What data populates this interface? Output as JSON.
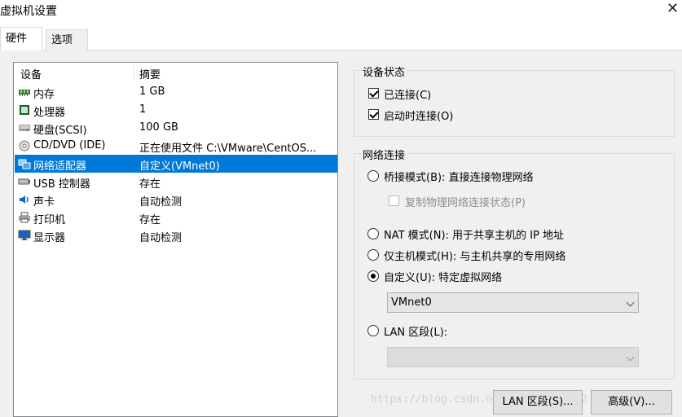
{
  "window": {
    "title": "虚拟机设置",
    "close_glyph": "✕"
  },
  "tabs": [
    {
      "label": "硬件"
    },
    {
      "label": "选项"
    }
  ],
  "device_list": {
    "headers": {
      "device": "设备",
      "summary": "摘要"
    },
    "rows": [
      {
        "name": "内存",
        "summary": "1 GB",
        "icon": "memory-icon"
      },
      {
        "name": "处理器",
        "summary": "1",
        "icon": "cpu-icon"
      },
      {
        "name": "硬盘(SCSI)",
        "summary": "100 GB",
        "icon": "harddisk-icon"
      },
      {
        "name": "CD/DVD (IDE)",
        "summary": "正在使用文件 C:\\VMware\\CentOS...",
        "icon": "cdrom-icon"
      },
      {
        "name": "网络适配器",
        "summary": "自定义(VMnet0)",
        "icon": "network-adapter-icon",
        "selected": true
      },
      {
        "name": "USB 控制器",
        "summary": "存在",
        "icon": "usb-icon"
      },
      {
        "name": "声卡",
        "summary": "自动检测",
        "icon": "sound-icon"
      },
      {
        "name": "打印机",
        "summary": "存在",
        "icon": "printer-icon"
      },
      {
        "name": "显示器",
        "summary": "自动检测",
        "icon": "display-icon"
      }
    ]
  },
  "device_status": {
    "group_label": "设备状态",
    "connected": {
      "label": "已连接(C)",
      "checked": true
    },
    "connect_at_power_on": {
      "label": "启动时连接(O)",
      "checked": true
    }
  },
  "network_connection": {
    "group_label": "网络连接",
    "bridged": {
      "label": "桥接模式(B): 直接连接物理网络",
      "selected": false
    },
    "replicate": {
      "label": "复制物理网络连接状态(P)",
      "checked": false,
      "disabled": true
    },
    "nat": {
      "label": "NAT 模式(N): 用于共享主机的 IP 地址",
      "selected": false
    },
    "host_only": {
      "label": "仅主机模式(H): 与主机共享的专用网络",
      "selected": false
    },
    "custom": {
      "label": "自定义(U): 特定虚拟网络",
      "selected": true
    },
    "custom_network": {
      "value": "VMnet0"
    },
    "lan_segment": {
      "label": "LAN 区段(L):",
      "selected": false
    },
    "lan_segment_select": {
      "value": ""
    }
  },
  "buttons": {
    "lan_segments": "LAN 区段(S)...",
    "advanced": "高级(V)..."
  },
  "watermark": "https://blog.csdn.net/weixin_4?952"
}
